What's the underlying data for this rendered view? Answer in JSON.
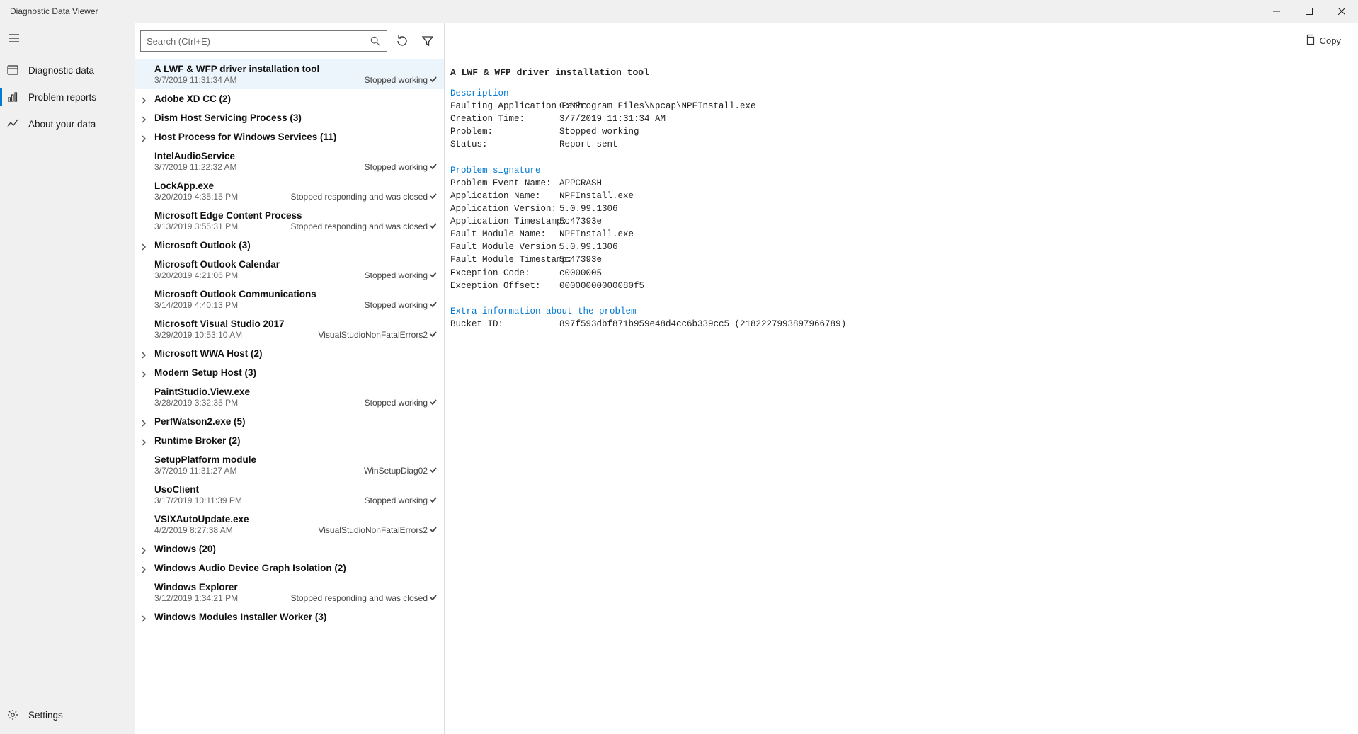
{
  "window": {
    "title": "Diagnostic Data Viewer"
  },
  "sidebar": {
    "items": [
      {
        "label": "Diagnostic data"
      },
      {
        "label": "Problem reports"
      },
      {
        "label": "About your data"
      }
    ],
    "settings": "Settings"
  },
  "search": {
    "placeholder": "Search (Ctrl+E)"
  },
  "copy": {
    "label": "Copy"
  },
  "list": [
    {
      "type": "item",
      "title": "A LWF & WFP driver installation tool",
      "ts": "3/7/2019 11:31:34 AM",
      "status": "Stopped working",
      "selected": true
    },
    {
      "type": "group",
      "title": "Adobe XD CC (2)"
    },
    {
      "type": "group",
      "title": "Dism Host Servicing Process (3)"
    },
    {
      "type": "group",
      "title": "Host Process for Windows Services (11)"
    },
    {
      "type": "item",
      "title": "IntelAudioService",
      "ts": "3/7/2019 11:22:32 AM",
      "status": "Stopped working"
    },
    {
      "type": "item",
      "title": "LockApp.exe",
      "ts": "3/20/2019 4:35:15 PM",
      "status": "Stopped responding and was closed"
    },
    {
      "type": "item",
      "title": "Microsoft Edge Content Process",
      "ts": "3/13/2019 3:55:31 PM",
      "status": "Stopped responding and was closed"
    },
    {
      "type": "group",
      "title": "Microsoft Outlook (3)"
    },
    {
      "type": "item",
      "title": "Microsoft Outlook Calendar",
      "ts": "3/20/2019 4:21:06 PM",
      "status": "Stopped working"
    },
    {
      "type": "item",
      "title": "Microsoft Outlook Communications",
      "ts": "3/14/2019 4:40:13 PM",
      "status": "Stopped working"
    },
    {
      "type": "item",
      "title": "Microsoft Visual Studio 2017",
      "ts": "3/29/2019 10:53:10 AM",
      "status": "VisualStudioNonFatalErrors2"
    },
    {
      "type": "group",
      "title": "Microsoft WWA Host (2)"
    },
    {
      "type": "group",
      "title": "Modern Setup Host (3)"
    },
    {
      "type": "item",
      "title": "PaintStudio.View.exe",
      "ts": "3/28/2019 3:32:35 PM",
      "status": "Stopped working"
    },
    {
      "type": "group",
      "title": "PerfWatson2.exe (5)"
    },
    {
      "type": "group",
      "title": "Runtime Broker (2)"
    },
    {
      "type": "item",
      "title": "SetupPlatform module",
      "ts": "3/7/2019 11:31:27 AM",
      "status": "WinSetupDiag02"
    },
    {
      "type": "item",
      "title": "UsoClient",
      "ts": "3/17/2019 10:11:39 PM",
      "status": "Stopped working"
    },
    {
      "type": "item",
      "title": "VSIXAutoUpdate.exe",
      "ts": "4/2/2019 8:27:38 AM",
      "status": "VisualStudioNonFatalErrors2"
    },
    {
      "type": "group",
      "title": "Windows (20)"
    },
    {
      "type": "group",
      "title": "Windows Audio Device Graph Isolation (2)"
    },
    {
      "type": "item",
      "title": "Windows Explorer",
      "ts": "3/12/2019 1:34:21 PM",
      "status": "Stopped responding and was closed"
    },
    {
      "type": "group",
      "title": "Windows Modules Installer Worker (3)"
    }
  ],
  "detail": {
    "title": "A LWF & WFP driver installation tool",
    "sections": [
      {
        "heading": "Description",
        "rows": [
          {
            "k": "Faulting Application Path:",
            "v": "C:\\Program Files\\Npcap\\NPFInstall.exe"
          },
          {
            "k": "Creation Time:",
            "v": "3/7/2019 11:31:34 AM"
          },
          {
            "k": "Problem:",
            "v": "Stopped working"
          },
          {
            "k": "Status:",
            "v": "Report sent"
          }
        ]
      },
      {
        "heading": "Problem signature",
        "rows": [
          {
            "k": "Problem Event Name:",
            "v": "APPCRASH"
          },
          {
            "k": "Application Name:",
            "v": "NPFInstall.exe"
          },
          {
            "k": "Application Version:",
            "v": "5.0.99.1306"
          },
          {
            "k": "Application Timestamp:",
            "v": "5c47393e"
          },
          {
            "k": "Fault Module Name:",
            "v": "NPFInstall.exe"
          },
          {
            "k": "Fault Module Version:",
            "v": "5.0.99.1306"
          },
          {
            "k": "Fault Module Timestamp:",
            "v": "5c47393e"
          },
          {
            "k": "Exception Code:",
            "v": "c0000005"
          },
          {
            "k": "Exception Offset:",
            "v": "00000000000080f5"
          }
        ]
      },
      {
        "heading": "Extra information about the problem",
        "rows": [
          {
            "k": "Bucket ID:",
            "v": "897f593dbf871b959e48d4cc6b339cc5 (2182227993897966789)"
          }
        ]
      }
    ]
  }
}
